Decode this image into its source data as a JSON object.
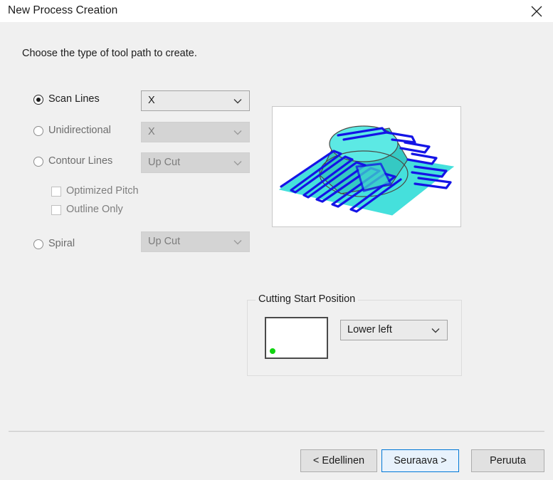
{
  "window": {
    "title": "New Process Creation",
    "close_icon": "close-icon"
  },
  "instruction": "Choose the type of tool path to create.",
  "options": [
    {
      "id": "scan-lines",
      "label": "Scan Lines",
      "checked": true,
      "enabled": true,
      "combo_value": "X",
      "combo_enabled": true
    },
    {
      "id": "unidirectional",
      "label": "Unidirectional",
      "checked": false,
      "enabled": false,
      "combo_value": "X",
      "combo_enabled": false
    },
    {
      "id": "contour-lines",
      "label": "Contour Lines",
      "checked": false,
      "enabled": false,
      "combo_value": "Up Cut",
      "combo_enabled": false
    },
    {
      "id": "spiral",
      "label": "Spiral",
      "checked": false,
      "enabled": false,
      "combo_value": "Up Cut",
      "combo_enabled": false
    }
  ],
  "checkboxes": [
    {
      "id": "optimized-pitch",
      "label": "Optimized Pitch",
      "checked": false,
      "enabled": false
    },
    {
      "id": "outline-only",
      "label": "Outline Only",
      "checked": false,
      "enabled": false
    }
  ],
  "preview": {
    "name": "tool-path-preview",
    "surface_color": "#45e0dc",
    "surface_color_dark": "#35b9b2",
    "path_color": "#1414e6",
    "edge_color": "#4a4a46"
  },
  "cutting_start_position": {
    "legend": "Cutting Start Position",
    "combo_value": "Lower left",
    "combo_enabled": true,
    "dot_color": "#11d411",
    "dot_position": "lower-left"
  },
  "footer": {
    "back_label": "< Edellinen",
    "next_label": "Seuraava >",
    "cancel_label": "Peruuta"
  }
}
